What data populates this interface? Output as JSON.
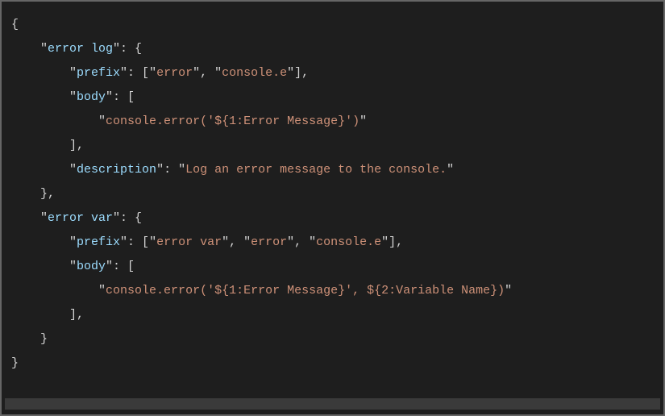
{
  "code": {
    "snippet1": {
      "name": "error log",
      "prefix_key": "prefix",
      "prefixes": [
        "error",
        "console.e"
      ],
      "body_key": "body",
      "body_line": "console.error('${1:Error Message}')",
      "description_key": "description",
      "description_val": "Log an error message to the console."
    },
    "snippet2": {
      "name": "error var",
      "prefix_key": "prefix",
      "prefixes": [
        "error var",
        "error",
        "console.e"
      ],
      "body_key": "body",
      "body_line": "console.error('${1:Error Message}', ${2:Variable Name})"
    }
  }
}
